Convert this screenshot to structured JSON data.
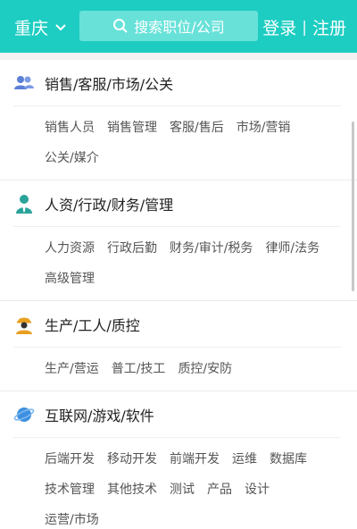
{
  "header": {
    "city": "重庆",
    "search_placeholder": "搜索职位/公司",
    "login": "登录",
    "separator": "|",
    "register": "注册"
  },
  "categories": [
    {
      "title": "销售/客服/市场/公关",
      "icon": "people-icon",
      "items": [
        "销售人员",
        "销售管理",
        "客服/售后",
        "市场/营销",
        "公关/媒介"
      ]
    },
    {
      "title": "人资/行政/财务/管理",
      "icon": "person-tie-icon",
      "items": [
        "人力资源",
        "行政后勤",
        "财务/审计/税务",
        "律师/法务",
        "高级管理"
      ]
    },
    {
      "title": "生产/工人/质控",
      "icon": "worker-icon",
      "items": [
        "生产/营运",
        "普工/技工",
        "质控/安防"
      ]
    },
    {
      "title": "互联网/游戏/软件",
      "icon": "planet-icon",
      "items": [
        "后端开发",
        "移动开发",
        "前端开发",
        "运维",
        "数据库",
        "技术管理",
        "其他技术",
        "测试",
        "产品",
        "设计",
        "运营/市场"
      ]
    }
  ],
  "colors": {
    "brand": "#1ecdc2",
    "search_bg": "#68e2d9"
  }
}
